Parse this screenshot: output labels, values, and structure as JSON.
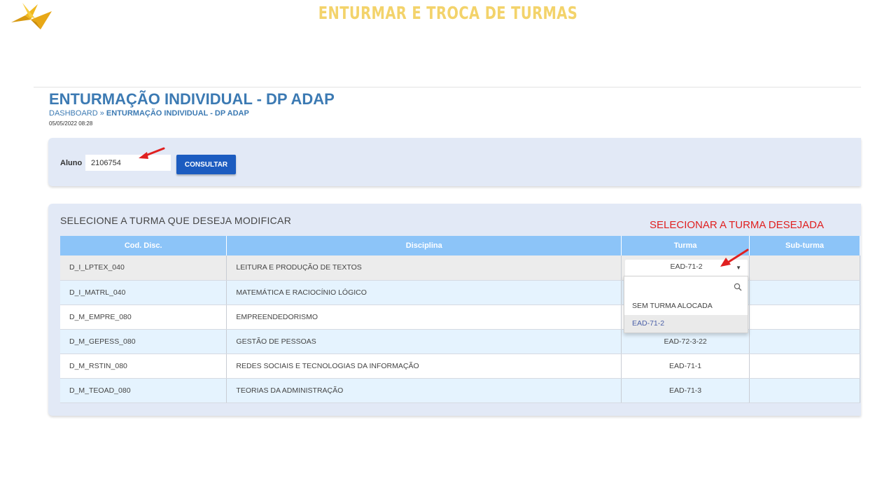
{
  "slide": {
    "title": "ENTURMAR E TROCA DE TURMAS",
    "annotation": "SELECIONAR A TURMA DESEJADA"
  },
  "page": {
    "title": "ENTURMAÇÃO INDIVIDUAL - DP ADAP",
    "breadcrumb": {
      "home": "DASHBOARD",
      "separator": " » ",
      "current": "ENTURMAÇÃO INDIVIDUAL - DP ADAP"
    },
    "timestamp": "05/05/2022 08:28"
  },
  "search": {
    "label": "Aluno",
    "value": "2106754",
    "button_label": "CONSULTAR"
  },
  "table": {
    "section_title": "SELECIONE A TURMA QUE DESEJA MODIFICAR",
    "headers": [
      "Cod. Disc.",
      "Disciplina",
      "Turma",
      "Sub-turma"
    ],
    "rows": [
      {
        "code": "D_I_LPTEX_040",
        "discipline": "LEITURA E PRODUÇÃO DE TEXTOS",
        "turma": "EAD-71-2",
        "subturma": ""
      },
      {
        "code": "D_I_MATRL_040",
        "discipline": "MATEMÁTICA E RACIOCÍNIO LÓGICO",
        "turma": "",
        "subturma": ""
      },
      {
        "code": "D_M_EMPRE_080",
        "discipline": "EMPREENDEDORISMO",
        "turma": "",
        "subturma": ""
      },
      {
        "code": "D_M_GEPESS_080",
        "discipline": "GESTÃO DE PESSOAS",
        "turma": "EAD-72-3-22",
        "subturma": ""
      },
      {
        "code": "D_M_RSTIN_080",
        "discipline": "REDES SOCIAIS E TECNOLOGIAS DA INFORMAÇÃO",
        "turma": "EAD-71-1",
        "subturma": ""
      },
      {
        "code": "D_M_TEOAD_080",
        "discipline": "TEORIAS DA ADMINISTRAÇÃO",
        "turma": "EAD-71-3",
        "subturma": ""
      }
    ]
  },
  "dropdown": {
    "selected": "EAD-71-2",
    "search_placeholder": "",
    "options": [
      "SEM TURMA ALOCADA",
      "EAD-71-2"
    ],
    "selected_index": 1
  },
  "colors": {
    "slide_title": "#f3d36b",
    "page_title": "#3c7ab3",
    "panel_bg": "#e2e9f6",
    "header_bg": "#8cc4f8",
    "button_bg": "#1c5cc0",
    "annotation": "#e02020",
    "arrow": "#e02020"
  },
  "icons": {
    "logo": "origami-bird-logo",
    "dropdown_caret": "caret-down-icon",
    "search": "search-icon",
    "pointer": "red-arrow-icon"
  }
}
